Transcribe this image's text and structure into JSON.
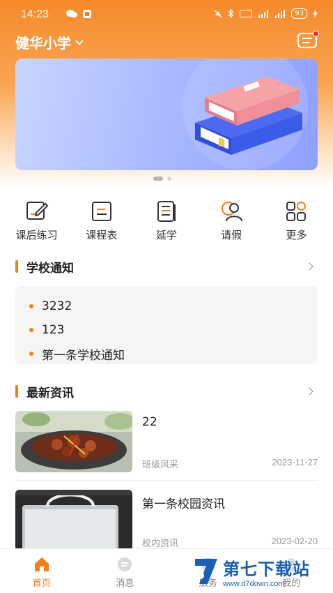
{
  "status_bar": {
    "time": "14:23",
    "battery": "93"
  },
  "header": {
    "school_name": "健华小学"
  },
  "banner": {
    "page_count": 2,
    "active_page": 1
  },
  "quick_actions": [
    {
      "label": "课后练习",
      "icon": "homework-pencil-icon"
    },
    {
      "label": "课程表",
      "icon": "schedule-icon"
    },
    {
      "label": "延学",
      "icon": "book-stack-icon"
    },
    {
      "label": "请假",
      "icon": "leave-person-icon"
    },
    {
      "label": "更多",
      "icon": "grid-more-icon"
    }
  ],
  "school_notice": {
    "title": "学校通知",
    "items": [
      "3232",
      "123",
      "第一条学校通知"
    ]
  },
  "news": {
    "title": "最新资讯",
    "items": [
      {
        "title": "22",
        "category": "班级风采",
        "date": "2023-11-27"
      },
      {
        "title": "第一条校园资讯",
        "category": "校内资讯",
        "date": "2023-02-20"
      }
    ]
  },
  "tab_bar": {
    "tabs": [
      {
        "label": "首页",
        "icon": "home-icon",
        "active": true
      },
      {
        "label": "消息",
        "icon": "message-icon",
        "active": false
      },
      {
        "label": "服务",
        "icon": "service-icon",
        "active": false
      },
      {
        "label": "我的",
        "icon": "profile-icon",
        "active": false
      }
    ]
  },
  "watermark": {
    "name": "第七下载站",
    "url": "www.d7down.com"
  },
  "colors": {
    "accent": "#f07f1c",
    "header_orange": "#f58a2a",
    "banner_blue": "#8fa0ff",
    "watermark_blue": "#1a5fb4"
  }
}
